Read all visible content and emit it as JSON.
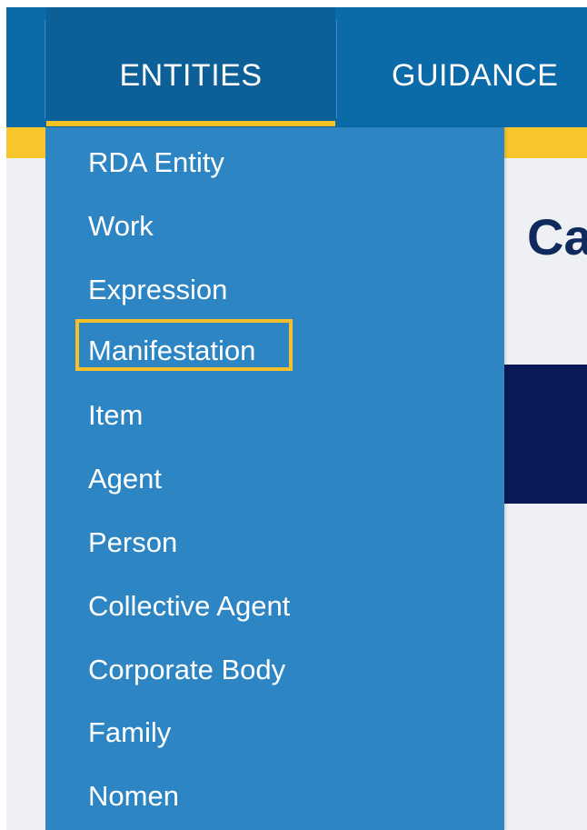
{
  "nav": {
    "tabs": [
      {
        "label": "ENTITIES",
        "active": true
      },
      {
        "label": "GUIDANCE",
        "active": false
      }
    ]
  },
  "page": {
    "heading_partial": "Ca"
  },
  "dropdown": {
    "items": [
      {
        "label": "RDA Entity"
      },
      {
        "label": "Work"
      },
      {
        "label": "Expression"
      },
      {
        "label": "Manifestation",
        "highlighted": true
      },
      {
        "label": "Item"
      },
      {
        "label": "Agent"
      },
      {
        "label": "Person"
      },
      {
        "label": "Collective Agent"
      },
      {
        "label": "Corporate Body"
      },
      {
        "label": "Family"
      },
      {
        "label": "Nomen"
      }
    ]
  },
  "colors": {
    "nav_bg": "#0b6aa8",
    "accent_yellow": "#f8c62c",
    "dropdown_bg": "#2d86c3",
    "heading_navy": "#0f2a5c"
  }
}
